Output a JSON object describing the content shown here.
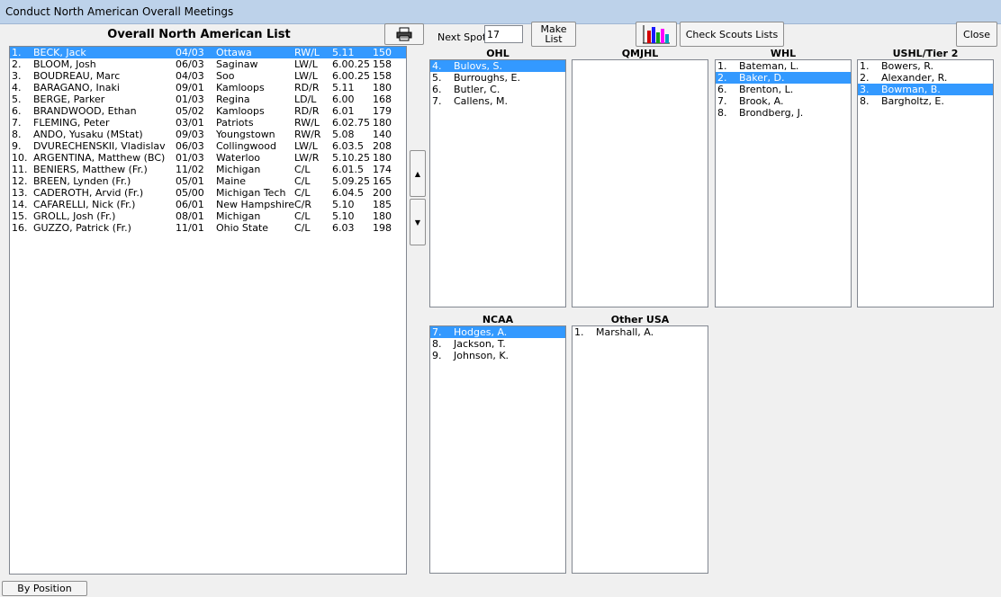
{
  "window": {
    "title": "Conduct North American Overall Meetings"
  },
  "overall": {
    "title": "Overall North American List",
    "rows": [
      {
        "num": "1.",
        "name": "BECK, Jack",
        "date": "04/03",
        "team": "Ottawa",
        "pos": "RW/L",
        "height": "5.11",
        "weight": "150",
        "selected": true
      },
      {
        "num": "2.",
        "name": "BLOOM, Josh",
        "date": "06/03",
        "team": "Saginaw",
        "pos": "LW/L",
        "height": "6.00.25",
        "weight": "158"
      },
      {
        "num": "3.",
        "name": "BOUDREAU, Marc",
        "date": "04/03",
        "team": "Soo",
        "pos": "LW/L",
        "height": "6.00.25",
        "weight": "158"
      },
      {
        "num": "4.",
        "name": "BARAGANO, Inaki",
        "date": "09/01",
        "team": "Kamloops",
        "pos": "RD/R",
        "height": "5.11",
        "weight": "180"
      },
      {
        "num": "5.",
        "name": "BERGE, Parker",
        "date": "01/03",
        "team": "Regina",
        "pos": "LD/L",
        "height": "6.00",
        "weight": "168"
      },
      {
        "num": "6.",
        "name": "BRANDWOOD, Ethan",
        "date": "05/02",
        "team": "Kamloops",
        "pos": "RD/R",
        "height": "6.01",
        "weight": "179"
      },
      {
        "num": "7.",
        "name": "FLEMING, Peter",
        "date": "03/01",
        "team": "Patriots",
        "pos": "RW/L",
        "height": "6.02.75",
        "weight": "180"
      },
      {
        "num": "8.",
        "name": "ANDO, Yusaku (MStat)",
        "date": "09/03",
        "team": "Youngstown",
        "pos": "RW/R",
        "height": "5.08",
        "weight": "140"
      },
      {
        "num": "9.",
        "name": "DVURECHENSKII, Vladislav",
        "date": "06/03",
        "team": "Collingwood",
        "pos": "LW/L",
        "height": "6.03.5",
        "weight": "208"
      },
      {
        "num": "10.",
        "name": "ARGENTINA, Matthew (BC)",
        "date": "01/03",
        "team": "Waterloo",
        "pos": "LW/R",
        "height": "5.10.25",
        "weight": "180"
      },
      {
        "num": "11.",
        "name": "BENIERS, Matthew (Fr.)",
        "date": "11/02",
        "team": "Michigan",
        "pos": "C/L",
        "height": "6.01.5",
        "weight": "174"
      },
      {
        "num": "12.",
        "name": "BREEN, Lynden (Fr.)",
        "date": "05/01",
        "team": "Maine",
        "pos": "C/L",
        "height": "5.09.25",
        "weight": "165"
      },
      {
        "num": "13.",
        "name": "CADEROTH, Arvid (Fr.)",
        "date": "05/00",
        "team": "Michigan Tech",
        "pos": "C/L",
        "height": "6.04.5",
        "weight": "200"
      },
      {
        "num": "14.",
        "name": "CAFARELLI, Nick (Fr.)",
        "date": "06/01",
        "team": "New Hampshire",
        "pos": "C/R",
        "height": "5.10",
        "weight": "185"
      },
      {
        "num": "15.",
        "name": "GROLL, Josh (Fr.)",
        "date": "08/01",
        "team": "Michigan",
        "pos": "C/L",
        "height": "5.10",
        "weight": "180"
      },
      {
        "num": "16.",
        "name": "GUZZO, Patrick (Fr.)",
        "date": "11/01",
        "team": "Ohio State",
        "pos": "C/L",
        "height": "6.03",
        "weight": "198"
      }
    ]
  },
  "toolbar": {
    "print_icon": "printer-icon",
    "next_spot_label": "Next Spot",
    "next_spot_value": "17",
    "make_list_line1": "Make",
    "make_list_line2": "List",
    "chart_icon": "bar-chart-icon",
    "check_scouts_label": "Check Scouts Lists",
    "close_label": "Close"
  },
  "move": {
    "up_glyph": "▲",
    "down_glyph": "▼"
  },
  "leagues": {
    "ohl": {
      "title": "OHL",
      "items": [
        {
          "num": "4.",
          "name": "Bulovs, S.",
          "selected": true
        },
        {
          "num": "5.",
          "name": "Burroughs, E."
        },
        {
          "num": "6.",
          "name": "Butler, C."
        },
        {
          "num": "7.",
          "name": "Callens, M."
        }
      ]
    },
    "qmjhl": {
      "title": "QMJHL",
      "items": []
    },
    "whl": {
      "title": "WHL",
      "items": [
        {
          "num": "1.",
          "name": "Bateman, L."
        },
        {
          "num": "2.",
          "name": "Baker, D.",
          "selected": true
        },
        {
          "num": "6.",
          "name": "Brenton, L."
        },
        {
          "num": "7.",
          "name": "Brook, A."
        },
        {
          "num": "8.",
          "name": "Brondberg, J."
        }
      ]
    },
    "ushl": {
      "title": "USHL/Tier 2",
      "items": [
        {
          "num": "1.",
          "name": "Bowers, R."
        },
        {
          "num": "2.",
          "name": "Alexander, R."
        },
        {
          "num": "3.",
          "name": "Bowman, B.",
          "selected": true
        },
        {
          "num": "8.",
          "name": "Bargholtz, E."
        }
      ]
    },
    "ncaa": {
      "title": "NCAA",
      "items": [
        {
          "num": "7.",
          "name": "Hodges, A.",
          "selected": true
        },
        {
          "num": "8.",
          "name": "Jackson, T."
        },
        {
          "num": "9.",
          "name": "Johnson, K."
        }
      ]
    },
    "other_usa": {
      "title": "Other USA",
      "items": [
        {
          "num": "1.",
          "name": "Marshall, A."
        }
      ]
    }
  },
  "footer": {
    "by_position_label": "By Position"
  },
  "colors": {
    "selection": "#3399ff",
    "titlebar": "#bdd2ea"
  }
}
